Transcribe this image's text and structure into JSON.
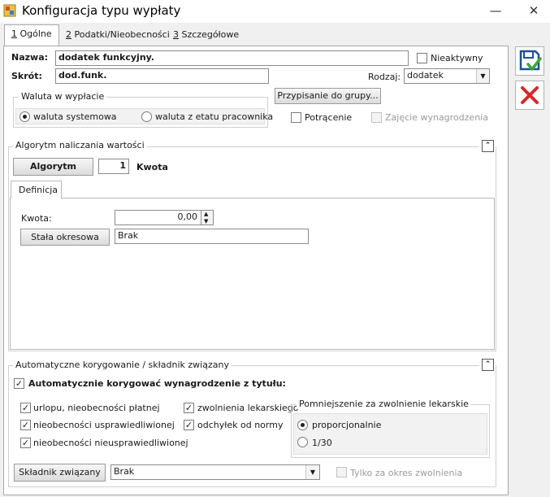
{
  "window": {
    "title": "Konfiguracja typu wypłaty",
    "minimize_glyph": "—",
    "close_glyph": "✕"
  },
  "tabs": [
    {
      "key": "1",
      "label": " Ogólne"
    },
    {
      "key": "2",
      "label": " Podatki/Nieobecności"
    },
    {
      "key": "3",
      "label": " Szczegółowe"
    }
  ],
  "general": {
    "nazwa_label": "Nazwa:",
    "nazwa_value": "dodatek funkcyjny.",
    "nieaktywny_label": "Nieaktywny",
    "nieaktywny_checked": false,
    "skrot_label": "Skrót:",
    "skrot_value": "dod.funk.",
    "rodzaj_label": "Rodzaj:",
    "rodzaj_value": "dodatek",
    "waluta_group_title": "Waluta w wypłacie",
    "waluta_systemowa_label": "waluta systemowa",
    "waluta_etatu_label": "waluta z etatu pracownika",
    "waluta_selected": "systemowa",
    "przypisanie_button": "Przypisanie do grupy...",
    "potracenie_label": "Potrącenie",
    "zajecie_label": "Zajęcie wynagrodzenia"
  },
  "algorithm": {
    "section_title": "Algorytm naliczania wartości",
    "algorytm_button": "Algorytm",
    "algorytm_number": "1",
    "algorytm_name": "Kwota",
    "definition_tab": "Definicja",
    "kwota_label": "Kwota:",
    "kwota_value": "0,00",
    "stala_button": "Stała okresowa",
    "stala_value": "Brak"
  },
  "correction": {
    "section_title": "Automatyczne korygowanie / składnik związany",
    "auto_label": "Automatycznie korygować wynagrodzenie z tytułu:",
    "items": [
      {
        "label": "urlopu, nieobecności płatnej",
        "checked": true
      },
      {
        "label": "nieobecności usprawiedliwionej",
        "checked": true
      },
      {
        "label": "nieobecności nieusprawiedliwionej",
        "checked": true
      },
      {
        "label": "zwolnienia lekarskiego",
        "checked": true
      },
      {
        "label": "odchyłek od normy",
        "checked": true
      }
    ],
    "reduction_group_title": "Pomniejszenie za zwolnienie lekarskie",
    "reduction_proportional": "proporcjonalnie",
    "reduction_fraction": "1/30",
    "reduction_selected": "proporcjonalnie",
    "skladnik_button": "Składnik związany",
    "skladnik_value": "Brak",
    "tylko_label": "Tylko za okres zwolnienia"
  },
  "colors": {
    "save_blue": "#1f4f9a",
    "save_check": "#3aa83a",
    "cancel_red": "#d8282a"
  }
}
